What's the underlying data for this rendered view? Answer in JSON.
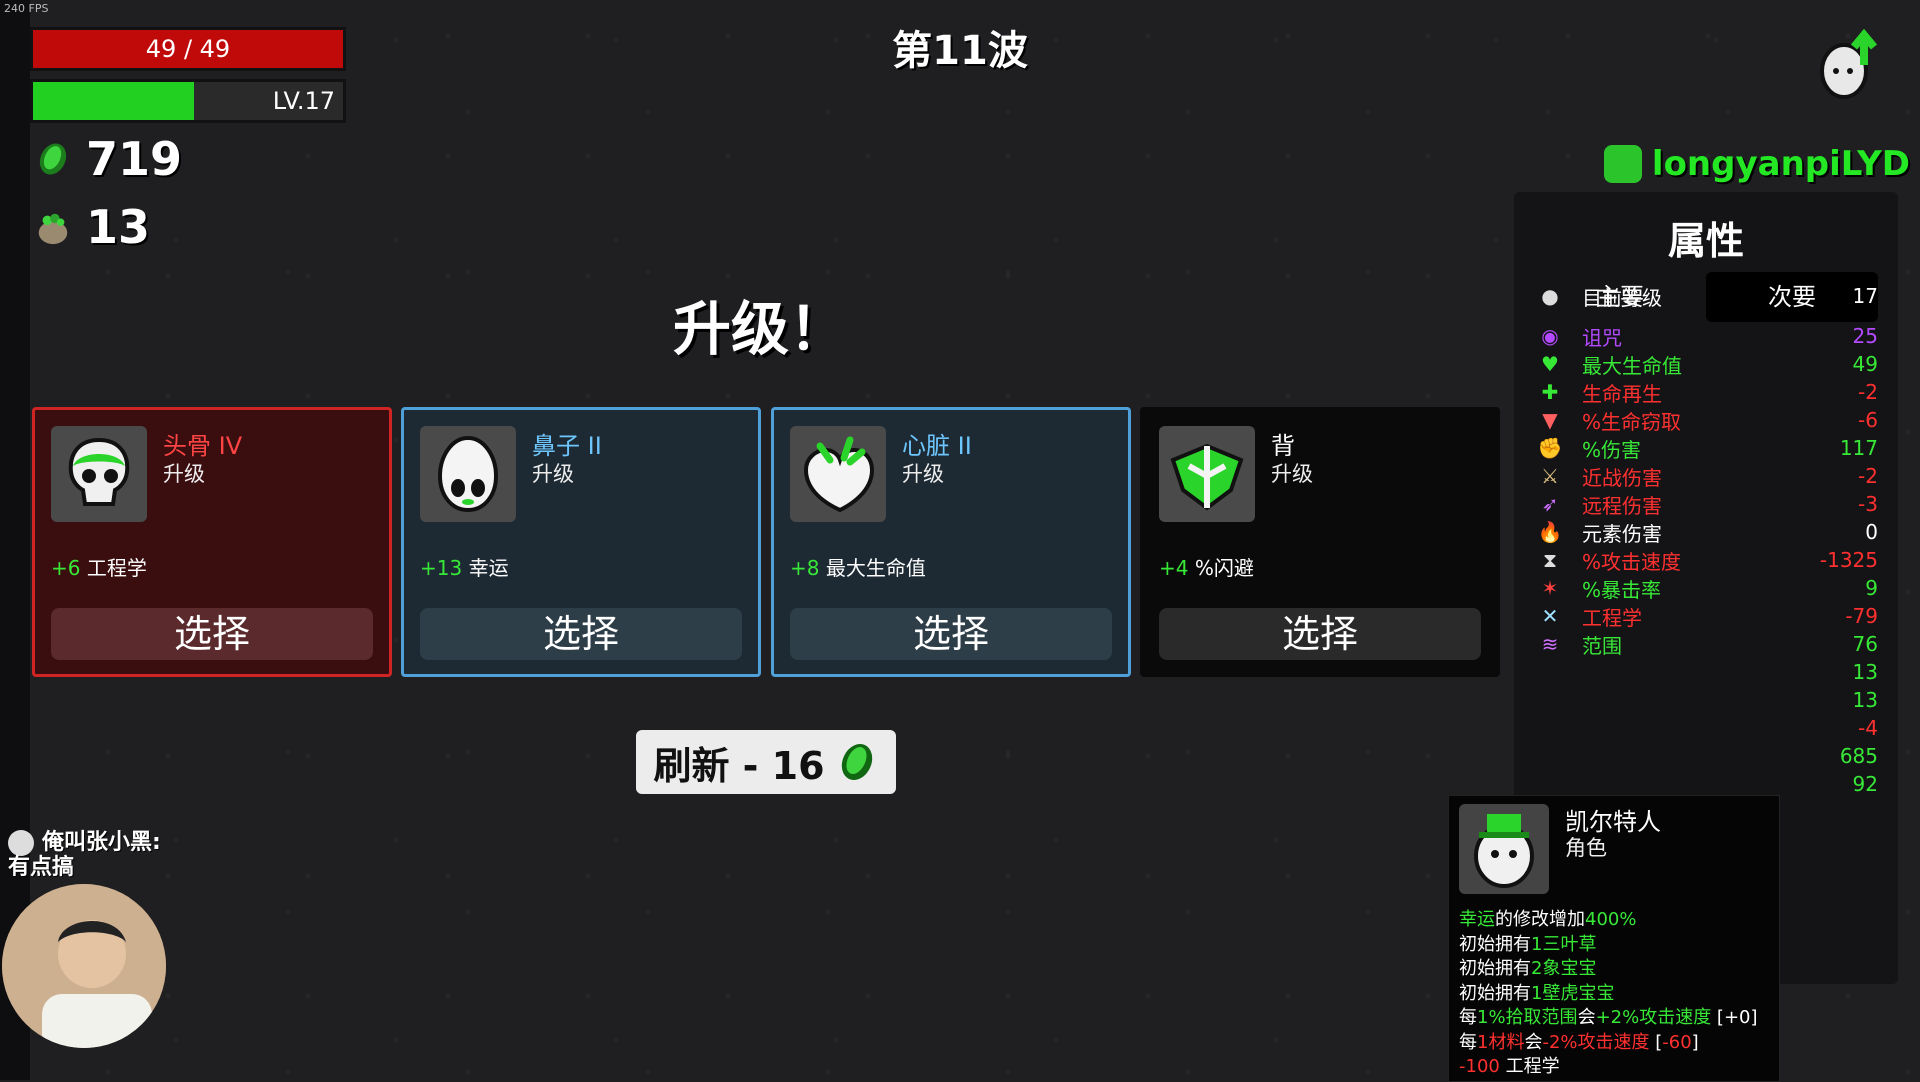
{
  "fps": "240 FPS",
  "hud": {
    "hp_text": "49 / 49",
    "hp_fraction": 1.0,
    "level_text": "LV.17",
    "xp_fraction": 0.52,
    "materials": "719",
    "bag_items": "13"
  },
  "wave_title": "第11波",
  "levelup_title": "升级！",
  "cards": [
    {
      "name": "头骨 IV",
      "subtitle": "升级",
      "stat_value": "+6",
      "stat_name": "工程学",
      "button": "选择",
      "tier": "red",
      "icon": "skull-icon"
    },
    {
      "name": "鼻子 II",
      "subtitle": "升级",
      "stat_value": "+13",
      "stat_name": "幸运",
      "button": "选择",
      "tier": "blue",
      "icon": "nose-icon"
    },
    {
      "name": "心脏 II",
      "subtitle": "升级",
      "stat_value": "+8",
      "stat_name": "最大生命值",
      "button": "选择",
      "tier": "blue",
      "icon": "heart-icon"
    },
    {
      "name": "背",
      "subtitle": "升级",
      "stat_value": "+4",
      "stat_name": "%闪避",
      "button": "选择",
      "tier": "black",
      "icon": "back-icon"
    }
  ],
  "reroll": {
    "label": "刷新 - 16"
  },
  "chat": {
    "user": "俺叫张小黑:",
    "message": "有点搞"
  },
  "username": "longyanpiLYD",
  "stats_panel": {
    "title": "属性",
    "tabs": [
      "主要",
      "次要"
    ],
    "active_tab": 1,
    "rows": [
      {
        "icon": "level-icon",
        "label": "目前等级",
        "value": "17",
        "color": "white"
      },
      {
        "icon": "curse-icon",
        "label": "诅咒",
        "value": "25",
        "color": "purple"
      },
      {
        "icon": "heart-icon",
        "label": "最大生命值",
        "value": "49",
        "color": "green"
      },
      {
        "icon": "regen-icon",
        "label": "生命再生",
        "value": "-2",
        "color": "red"
      },
      {
        "icon": "lifesteal-icon",
        "label": "%生命窃取",
        "value": "-6",
        "color": "red"
      },
      {
        "icon": "damage-icon",
        "label": "%伤害",
        "value": "117",
        "color": "green"
      },
      {
        "icon": "melee-icon",
        "label": "近战伤害",
        "value": "-2",
        "color": "red"
      },
      {
        "icon": "ranged-icon",
        "label": "远程伤害",
        "value": "-3",
        "color": "red"
      },
      {
        "icon": "elemental-icon",
        "label": "元素伤害",
        "value": "0",
        "color": "white"
      },
      {
        "icon": "attack-speed-icon",
        "label": "%攻击速度",
        "value": "-1325",
        "color": "red"
      },
      {
        "icon": "crit-icon",
        "label": "%暴击率",
        "value": "9",
        "color": "green"
      },
      {
        "icon": "engineering-icon",
        "label": "工程学",
        "value": "-79",
        "color": "red"
      },
      {
        "icon": "range-icon",
        "label": "范围",
        "value": "76",
        "color": "green"
      },
      {
        "icon": "",
        "label": "",
        "value": "13",
        "color": "green"
      },
      {
        "icon": "",
        "label": "",
        "value": "13",
        "color": "green"
      },
      {
        "icon": "",
        "label": "",
        "value": "-4",
        "color": "red"
      },
      {
        "icon": "",
        "label": "",
        "value": "685",
        "color": "green"
      },
      {
        "icon": "",
        "label": "",
        "value": "92",
        "color": "green"
      }
    ]
  },
  "character": {
    "name": "凯尔特人",
    "role": "角色",
    "lines": [
      [
        [
          "幸运",
          "g"
        ],
        [
          "的修改增加",
          "w"
        ],
        [
          "400%",
          "g"
        ]
      ],
      [
        [
          "初始拥有",
          "w"
        ],
        [
          "1三叶草",
          "g"
        ]
      ],
      [
        [
          "初始拥有",
          "w"
        ],
        [
          "2象宝宝",
          "g"
        ]
      ],
      [
        [
          "初始拥有",
          "w"
        ],
        [
          "1壁虎宝宝",
          "g"
        ]
      ],
      [
        [
          "每",
          "w"
        ],
        [
          "1%拾取范围",
          "g"
        ],
        [
          "会",
          "w"
        ],
        [
          "+2%攻击速度",
          "g"
        ],
        [
          " [+0]",
          "w"
        ]
      ],
      [
        [
          "每",
          "w"
        ],
        [
          "1材料",
          "r"
        ],
        [
          "会",
          "w"
        ],
        [
          "-2%攻击速度",
          "r"
        ],
        [
          " [",
          "w"
        ],
        [
          "-60",
          "r"
        ],
        [
          "]",
          "w"
        ]
      ],
      [
        [
          "-100",
          "r"
        ],
        [
          " 工程学",
          "w"
        ]
      ]
    ]
  },
  "colors": {
    "hp": "#c00a0a",
    "xp": "#22d022",
    "positive": "#37e837",
    "negative": "#ff3030",
    "curse": "#b34aff",
    "card_red_border": "#d02525",
    "card_blue_border": "#4fa0d8"
  }
}
